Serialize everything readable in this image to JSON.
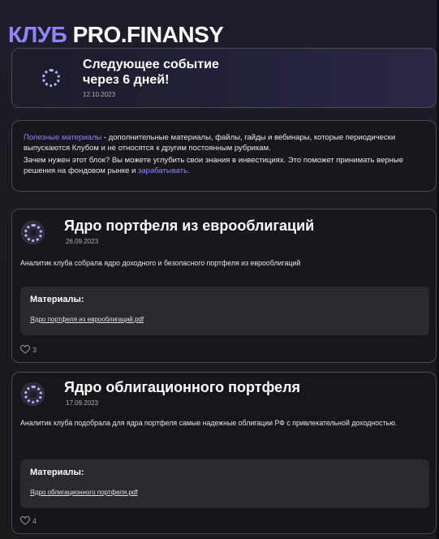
{
  "header": {
    "accent": "КЛУБ",
    "main": "PRO.FINANSY"
  },
  "event": {
    "title_line1": "Следующее событие",
    "title_line2": "через 6 дней!",
    "date": "12.10.2023"
  },
  "info": {
    "link_text": "Полезные материалы",
    "text_1": " - дополнительные материалы, файлы, гайды и вебинары, которые периодически выпускаются Клубом и не относятся к другим постоянным рубрикам.",
    "text_2": "Зачем нужен этот блок? Вы можете углубить свои знания в инвестициях. Это поможет принимать верные решения на фондовом рынке и ",
    "link_text_2": "зарабатывать."
  },
  "posts": [
    {
      "title": "Ядро портфеля из еврооблигаций",
      "date": "26.09.2023",
      "description": "Аналитик клуба собрала ядро доходного и безопасного портфеля из еврооблигаций",
      "materials_label": "Материалы:",
      "file": "Ядро портфеля из еврооблигаций.pdf",
      "likes": "3"
    },
    {
      "title": "Ядро облигационного портфеля",
      "date": "17.09.2023",
      "description": "Аналитик клуба подобрала для ядра портфеля самые надежные облигации РФ с привлекательной доходностью.",
      "materials_label": "Материалы:",
      "file": "Ядро облигационного портфеля.pdf",
      "likes": "4"
    }
  ],
  "colors": {
    "accent": "#8f86ff",
    "background": "#1b1b1f",
    "card_border": "#4a4954"
  },
  "icons": {
    "logo": "club-ring-logo-icon",
    "like": "heart-icon"
  }
}
